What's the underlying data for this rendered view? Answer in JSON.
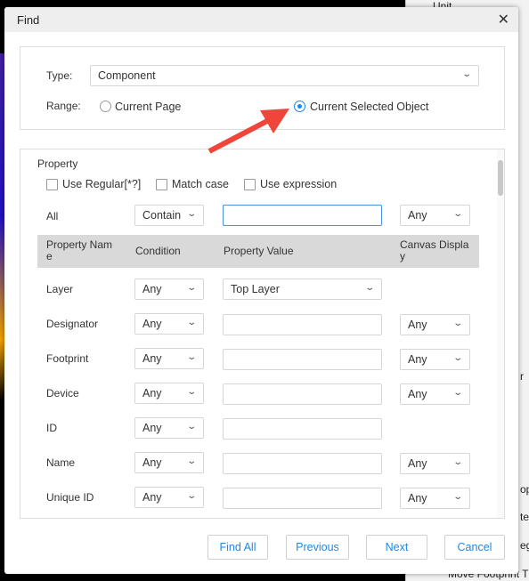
{
  "background": {
    "fragments": [
      "Unit",
      "r",
      "op",
      "te",
      "eg",
      "Move Footprint Th"
    ]
  },
  "dialog": {
    "title": "Find",
    "type_label": "Type:",
    "type_value": "Component",
    "range_label": "Range:",
    "range_options": [
      {
        "label": "Current Page",
        "selected": false
      },
      {
        "label": "Current Selected Object",
        "selected": true
      }
    ],
    "property": {
      "title": "Property",
      "checkboxes": [
        {
          "label": "Use Regular[*?]",
          "checked": false
        },
        {
          "label": "Match case",
          "checked": false
        },
        {
          "label": "Use expression",
          "checked": false
        }
      ],
      "all_row": {
        "label": "All",
        "condition": "Contain",
        "value": "",
        "display": "Any"
      },
      "headers": {
        "name": "Property Nam e",
        "condition": "Condition",
        "value": "Property Value",
        "display": "Canvas Displa y"
      },
      "rows": [
        {
          "name": "Layer",
          "condition": "Any",
          "value": "Top Layer",
          "display": null
        },
        {
          "name": "Designator",
          "condition": "Any",
          "value": "",
          "display": "Any"
        },
        {
          "name": "Footprint",
          "condition": "Any",
          "value": "",
          "display": "Any"
        },
        {
          "name": "Device",
          "condition": "Any",
          "value": "",
          "display": "Any"
        },
        {
          "name": "ID",
          "condition": "Any",
          "value": "",
          "display": null
        },
        {
          "name": "Name",
          "condition": "Any",
          "value": "",
          "display": "Any"
        },
        {
          "name": "Unique ID",
          "condition": "Any",
          "value": "",
          "display": "Any"
        }
      ]
    },
    "buttons": {
      "find_all": "Find All",
      "previous": "Previous",
      "next": "Next",
      "cancel": "Cancel"
    }
  },
  "colors": {
    "accent": "#1e88e5",
    "arrow": "#f0453a"
  }
}
